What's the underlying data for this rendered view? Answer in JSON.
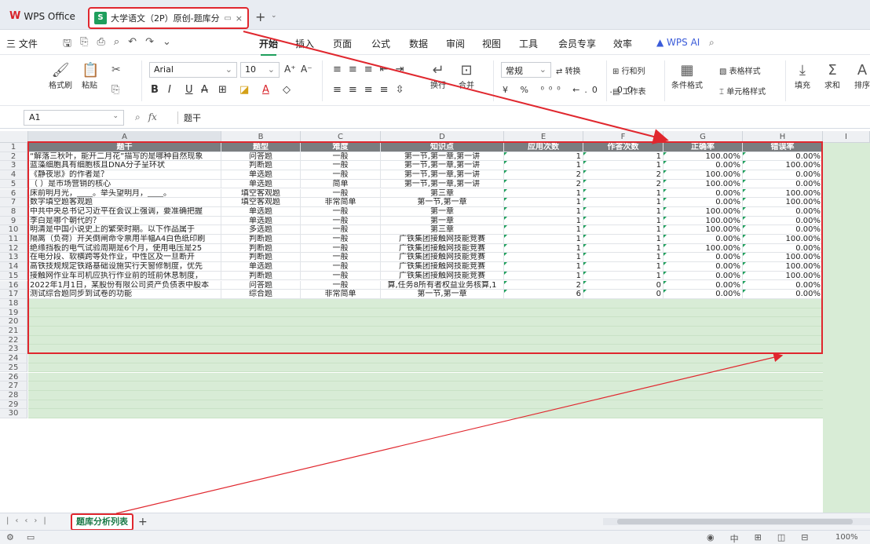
{
  "titlebar": {
    "app": "WPS Office",
    "doc_tab": "大学语文（2P）原创-题库分析",
    "new_tab": "+"
  },
  "menu": {
    "file": "三 文件",
    "tabs": [
      "开始",
      "插入",
      "页面",
      "公式",
      "数据",
      "审阅",
      "视图",
      "工具",
      "会员专享",
      "效率"
    ],
    "wps_ai": "WPS AI"
  },
  "ribbon": {
    "format_painter": "格式刷",
    "paste": "粘贴",
    "font_name": "Arial",
    "font_size": "10",
    "number_format": "常规",
    "convert": "转换",
    "rows_cols": "行和列",
    "worksheet": "工作表",
    "wrap": "换行",
    "merge": "合并",
    "cond_format": "条件格式",
    "table_style": "表格样式",
    "cell_style": "单元格样式",
    "fill": "填充",
    "sum": "求和",
    "sort": "排序"
  },
  "formula": {
    "cell_ref": "A1",
    "value": "题干"
  },
  "columns": [
    "A",
    "B",
    "C",
    "D",
    "E",
    "F",
    "G",
    "H",
    "I"
  ],
  "header_row": [
    "题干",
    "题型",
    "难度",
    "知识点",
    "应用次数",
    "作答次数",
    "正确率",
    "错误率"
  ],
  "rows": [
    [
      "“解落三秋叶，能开二月花”描写的是哪种自然现象",
      "问答题",
      "一般",
      "第一节,第一章,第一讲",
      "1",
      "1",
      "100.00%",
      "0.00%"
    ],
    [
      "蓝藻细胞具有细胞核且DNA分子呈环状",
      "判断题",
      "一般",
      "第一节,第一章,第一讲",
      "1",
      "1",
      "0.00%",
      "100.00%"
    ],
    [
      "《静夜思》的作者是？",
      "单选题",
      "一般",
      "第一节,第一章,第一讲",
      "2",
      "2",
      "100.00%",
      "0.00%"
    ],
    [
      "（ ）是市场营销的核心",
      "单选题",
      "简单",
      "第一节,第一章,第一讲",
      "2",
      "2",
      "100.00%",
      "0.00%"
    ],
    [
      "床前明月光，____。举头望明月，____。",
      "填空客观题",
      "一般",
      "第三章",
      "1",
      "1",
      "0.00%",
      "100.00%"
    ],
    [
      "数字填空题客观题",
      "填空客观题",
      "非常简单",
      "第一节,第一章",
      "1",
      "1",
      "0.00%",
      "100.00%"
    ],
    [
      "中共中央总书记习近平在会议上强调，要准确把握",
      "单选题",
      "一般",
      "第一章",
      "1",
      "1",
      "100.00%",
      "0.00%"
    ],
    [
      "李白是哪个朝代的？",
      "单选题",
      "一般",
      "第一章",
      "1",
      "1",
      "100.00%",
      "0.00%"
    ],
    [
      "明清是中国小说史上的繁荣时期。以下作品属于",
      "多选题",
      "一般",
      "第三章",
      "1",
      "1",
      "100.00%",
      "0.00%"
    ],
    [
      "隔离（负荷）开关倒闸命令票用半幅A4白色纸印刷",
      "判断题",
      "一般",
      "广铁集团接触网技能竞赛",
      "1",
      "1",
      "0.00%",
      "100.00%"
    ],
    [
      "绝缘挡板的电气试验周期是6个月，使用电压是25",
      "判断题",
      "一般",
      "广铁集团接触网技能竞赛",
      "1",
      "1",
      "100.00%",
      "0.00%"
    ],
    [
      "在电分段、软横跨等处作业，中性区及一旦断开",
      "判断题",
      "一般",
      "广铁集团接触网技能竞赛",
      "1",
      "1",
      "0.00%",
      "100.00%"
    ],
    [
      "高铁技规规定铁路基础设施实行天窗修制度，优先",
      "单选题",
      "一般",
      "广铁集团接触网技能竞赛",
      "1",
      "1",
      "0.00%",
      "100.00%"
    ],
    [
      "接触网作业车司机应执行作业前的班前休息制度，",
      "判断题",
      "一般",
      "广铁集团接触网技能竞赛",
      "1",
      "1",
      "0.00%",
      "100.00%"
    ],
    [
      "2022年1月1日，某股份有限公司资产负债表中股本",
      "问答题",
      "一般",
      "算,任务8所有者权益业务核算,1",
      "2",
      "0",
      "0.00%",
      "0.00%"
    ],
    [
      "测试综合题同步到试卷的功能",
      "综合题",
      "非常简单",
      "第一节,第一章",
      "6",
      "0",
      "0.00%",
      "0.00%"
    ]
  ],
  "empty_rows": [
    "18",
    "19",
    "20",
    "21",
    "22",
    "23",
    "24",
    "25",
    "26",
    "27",
    "28",
    "29",
    "30"
  ],
  "sheet_tab": "题库分析列表",
  "status": {
    "zoom": "100%"
  },
  "colors": {
    "accent": "#1e9f5c",
    "highlight": "#e0272e",
    "header_fill": "#7a7d80"
  }
}
